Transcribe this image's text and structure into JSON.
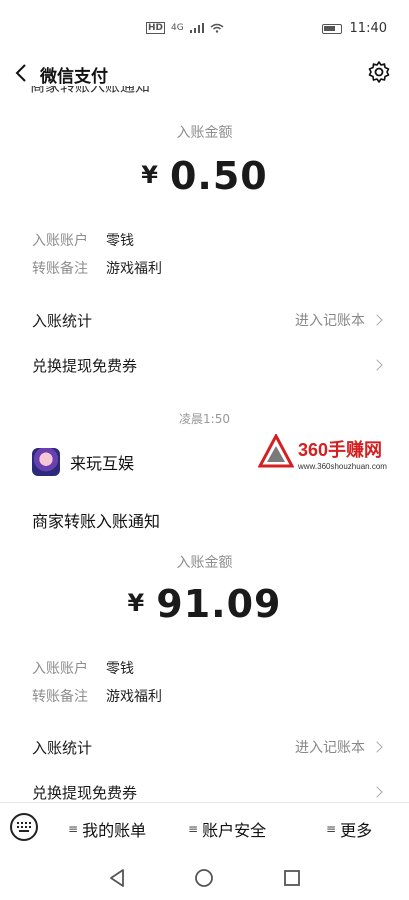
{
  "statusbar": {
    "center_hd": "HD",
    "center_4g": "4G",
    "time": "11:40"
  },
  "nav": {
    "title": "微信支付"
  },
  "cutoff_text": "商家转账入账通知",
  "notice1": {
    "amount_label": "入账金额",
    "currency": "¥",
    "amount": "0.50",
    "account_key": "入账账户",
    "account_val": "零钱",
    "memo_key": "转账备注",
    "memo_val": "游戏福利",
    "stats_label": "入账统计",
    "stats_link": "进入记账本",
    "voucher_label": "兑换提现免费券"
  },
  "time_stamp": "凌晨1:50",
  "merchant": {
    "name": "来玩互娱"
  },
  "watermark": {
    "line1": "360手赚网",
    "line2": "www.360shouzhuan.com"
  },
  "notice2": {
    "title": "商家转账入账通知",
    "amount_label": "入账金额",
    "currency": "¥",
    "amount": "91.09",
    "account_key": "入账账户",
    "account_val": "零钱",
    "memo_key": "转账备注",
    "memo_val": "游戏福利",
    "stats_label": "入账统计",
    "stats_link": "进入记账本",
    "voucher_label": "兑换提现免费券"
  },
  "menu": {
    "item1": "我的账单",
    "item2": "账户安全",
    "item3": "更多"
  },
  "colors": {
    "accent": "#d42020",
    "muted": "#8e8e8e"
  }
}
